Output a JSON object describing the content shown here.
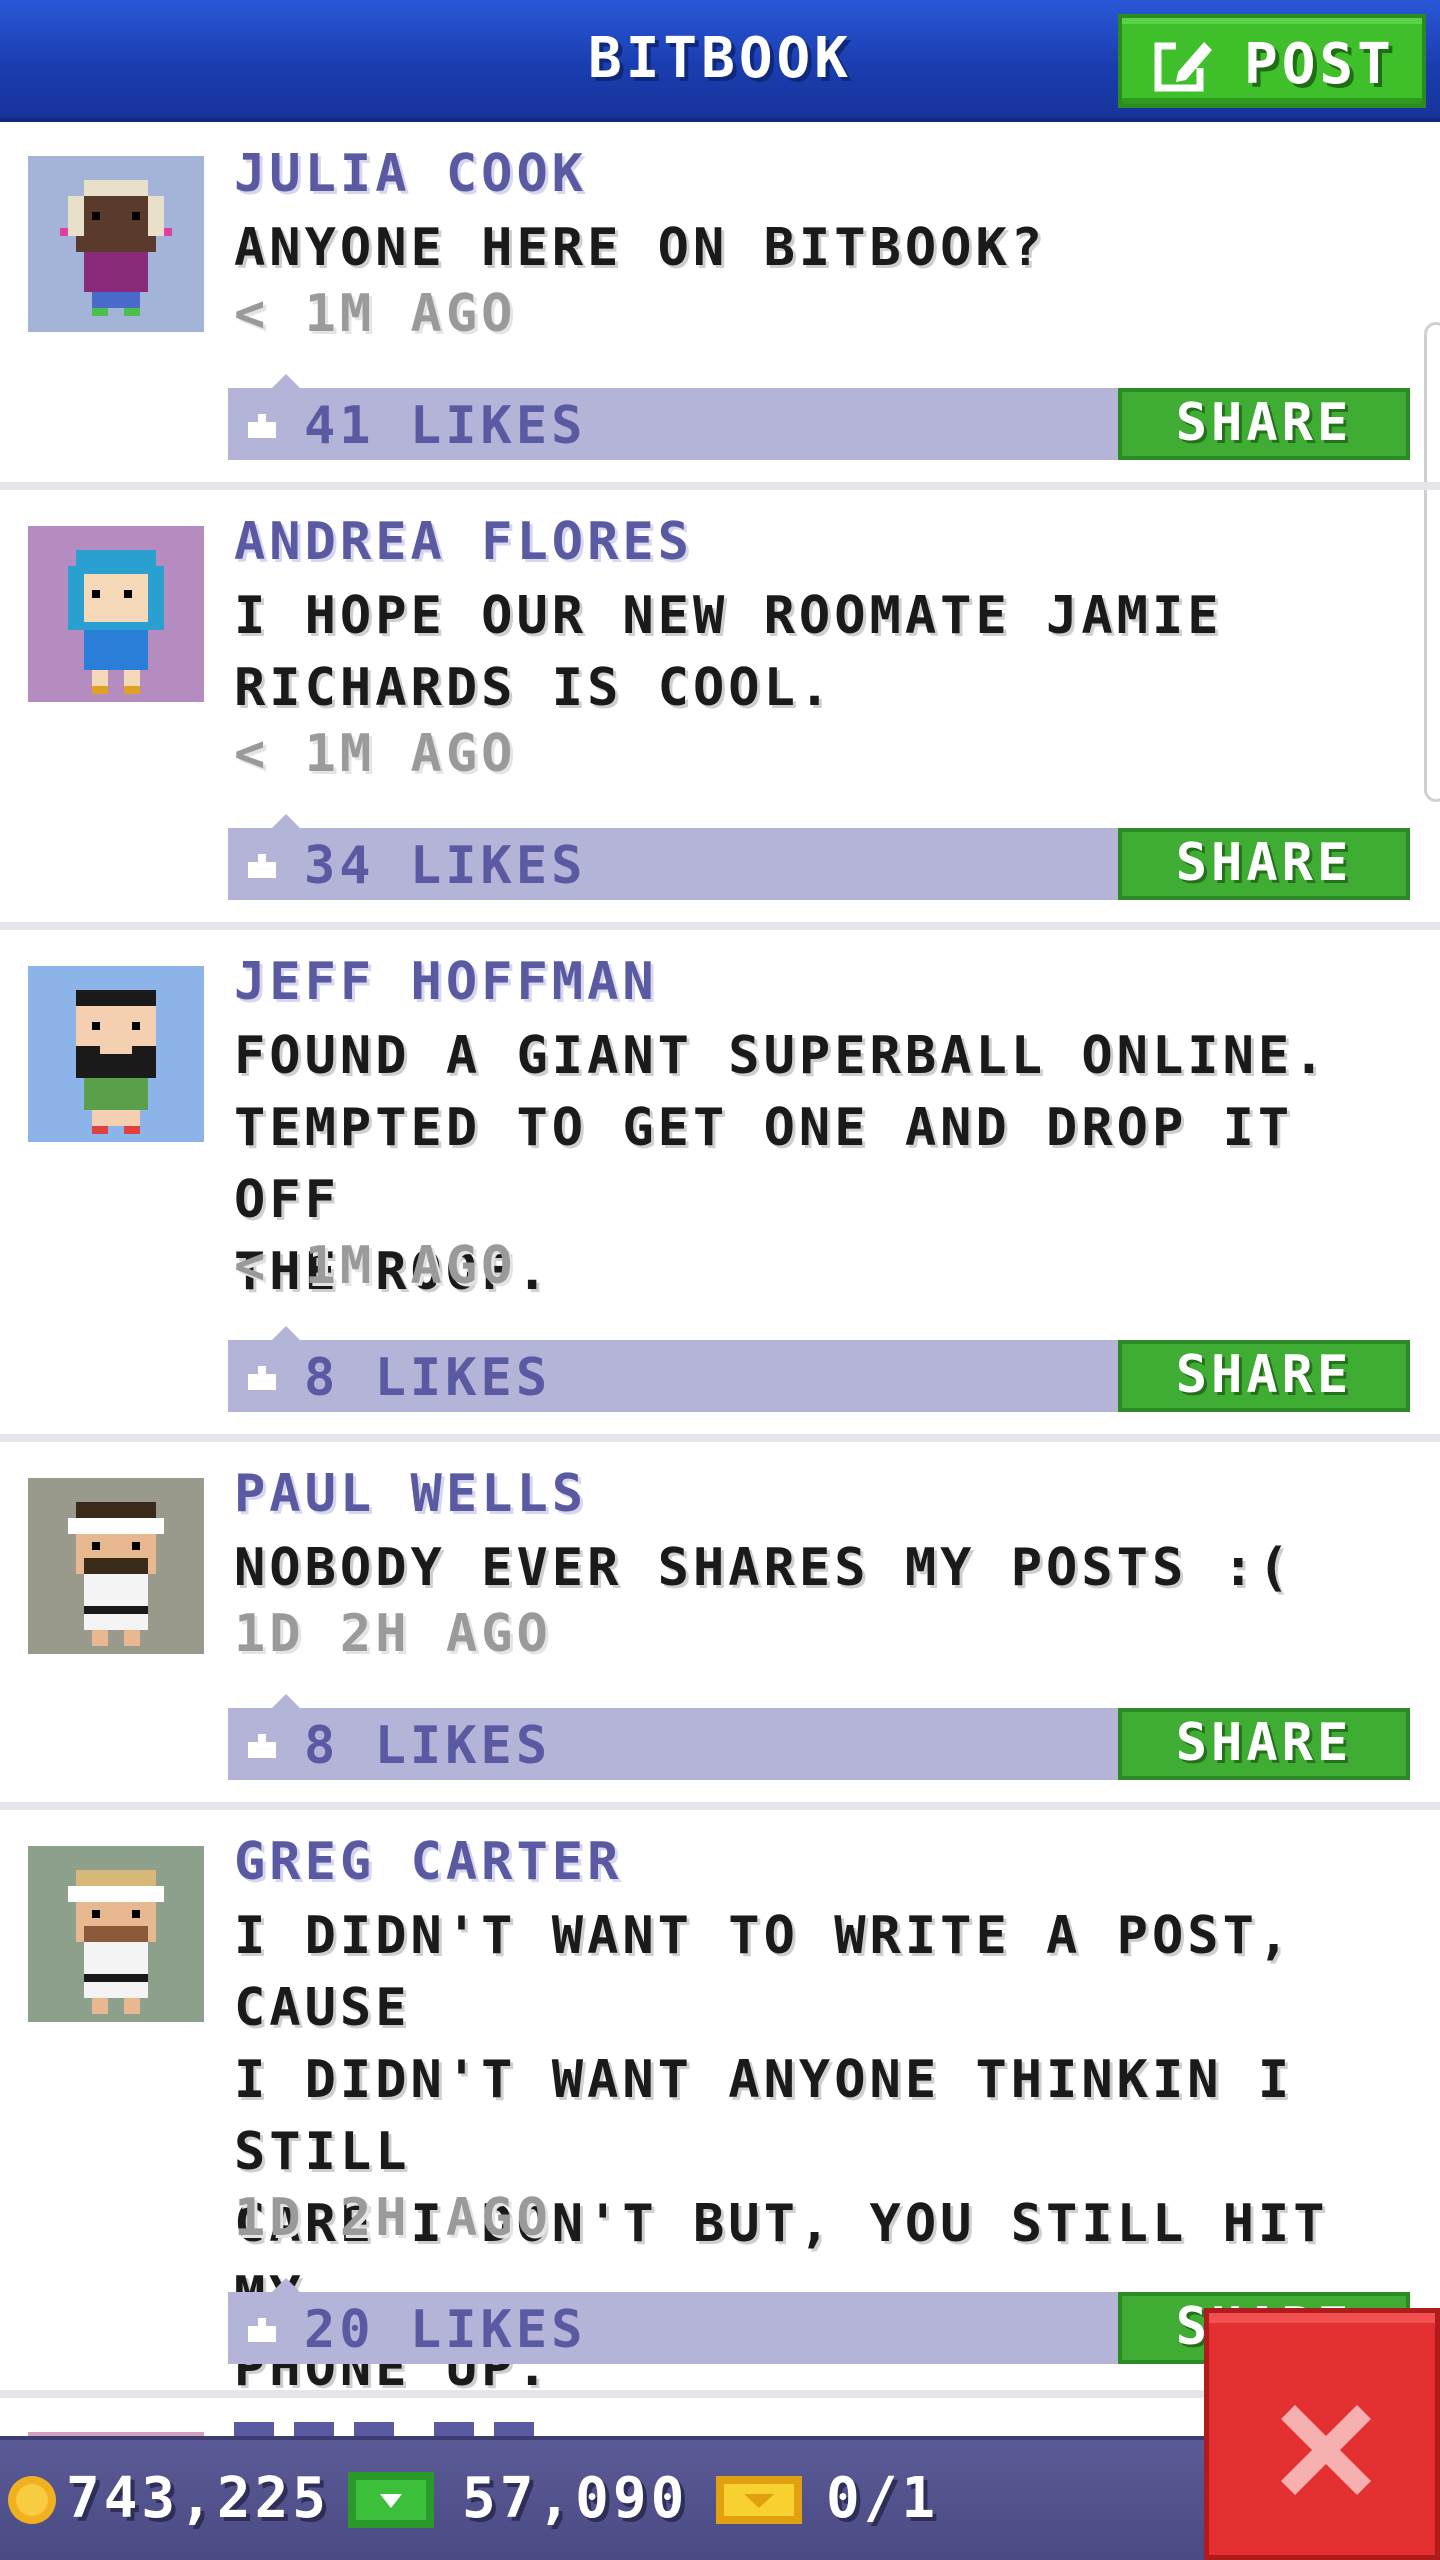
{
  "header": {
    "title": "BITBOOK",
    "post_label": "POST"
  },
  "posts": [
    {
      "author": "JULIA COOK",
      "message": "ANYONE HERE ON BITBOOK?",
      "time": "< 1M AGO",
      "likes": "41 LIKES",
      "share_label": "SHARE",
      "avatar_bg": "#a4b4d8"
    },
    {
      "author": "ANDREA FLORES",
      "message": "I HOPE OUR NEW ROOMATE JAMIE\nRICHARDS IS COOL.",
      "time": "< 1M AGO",
      "likes": "34 LIKES",
      "share_label": "SHARE",
      "avatar_bg": "#b48cc0"
    },
    {
      "author": "JEFF HOFFMAN",
      "message": "FOUND A GIANT SUPERBALL ONLINE.\nTEMPTED TO GET ONE AND DROP IT OFF\nTHE ROOF.",
      "time": "< 1M AGO",
      "likes": "8 LIKES",
      "share_label": "SHARE",
      "avatar_bg": "#8cb4e8"
    },
    {
      "author": "PAUL WELLS",
      "message": "NOBODY EVER SHARES MY POSTS :(",
      "time": "1D 2H AGO",
      "likes": "8 LIKES",
      "share_label": "SHARE",
      "avatar_bg": "#9a9a8c"
    },
    {
      "author": "GREG CARTER",
      "message": "I DIDN'T WANT TO WRITE A POST, CAUSE\nI DIDN'T WANT ANYONE THINKIN I STILL\nCARE I DON'T BUT, YOU STILL HIT MY\nPHONE UP.",
      "time": "1D 2H AGO",
      "likes": "20 LIKES",
      "share_label": "SHARE",
      "avatar_bg": "#8ca08c"
    }
  ],
  "footer": {
    "coins": "743,225",
    "bux": "57,090",
    "tickets": "0/1"
  },
  "colors": {
    "header": "#1a3eb0",
    "post_button": "#3fbf2a",
    "share_button": "#3fad34",
    "likes_bar": "#b4b4d8",
    "author": "#5a5aa2",
    "footer": "#4a4a84",
    "close_button": "#e43030"
  },
  "icons": {
    "post": "edit-icon",
    "like": "thumbs-up-icon",
    "coin": "coin-icon",
    "bux": "bux-icon",
    "ticket": "ticket-icon",
    "close": "close-icon"
  }
}
